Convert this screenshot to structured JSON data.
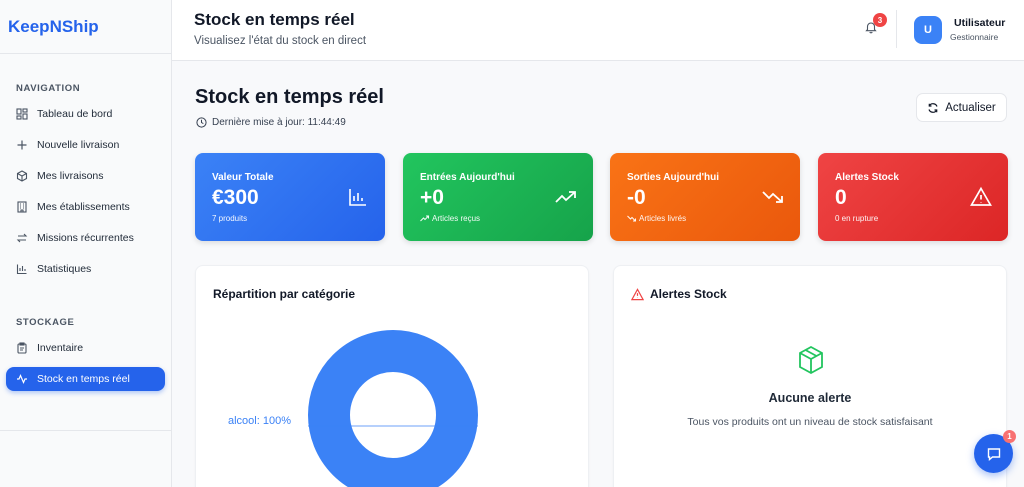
{
  "app": {
    "brand": "KeepNShip"
  },
  "sidebar": {
    "nav_title": "NAVIGATION",
    "nav_items": [
      {
        "label": "Tableau de bord",
        "icon": "dashboard-icon"
      },
      {
        "label": "Nouvelle livraison",
        "icon": "plus-icon"
      },
      {
        "label": "Mes livraisons",
        "icon": "package-icon"
      },
      {
        "label": "Mes établissements",
        "icon": "building-icon"
      },
      {
        "label": "Missions récurrentes",
        "icon": "repeat-icon"
      },
      {
        "label": "Statistiques",
        "icon": "bar-chart-icon"
      }
    ],
    "storage_title": "STOCKAGE",
    "storage_items": [
      {
        "label": "Inventaire",
        "icon": "clipboard-icon"
      },
      {
        "label": "Stock en temps réel",
        "icon": "activity-icon",
        "active": true
      }
    ]
  },
  "header": {
    "title": "Stock en temps réel",
    "subtitle": "Visualisez l'état du stock en direct",
    "notification_count": "3",
    "user": {
      "initial": "U",
      "name": "Utilisateur",
      "role": "Gestionnaire"
    }
  },
  "main": {
    "title": "Stock en temps réel",
    "last_update": "Dernière mise à jour: 11:44:49",
    "refresh_label": "Actualiser",
    "cards": [
      {
        "label": "Valeur Totale",
        "value": "€300",
        "sub": "7 produits",
        "icon": "bar-chart-icon",
        "color": "#2563eb"
      },
      {
        "label": "Entrées Aujourd'hui",
        "value": "+0",
        "sub": "Articles reçus",
        "icon": "trending-up-icon",
        "color": "#16a34a"
      },
      {
        "label": "Sorties Aujourd'hui",
        "value": "-0",
        "sub": "Articles livrés",
        "icon": "trending-down-icon",
        "color": "#ea580c"
      },
      {
        "label": "Alertes Stock",
        "value": "0",
        "sub": "0 en rupture",
        "icon": "alert-triangle-icon",
        "color": "#dc2626"
      }
    ],
    "category_panel": {
      "title": "Répartition par catégorie"
    },
    "alerts_panel": {
      "title": "Alertes Stock",
      "empty_title": "Aucune alerte",
      "empty_sub": "Tous vos produits ont un niveau de stock satisfaisant"
    }
  },
  "chart_data": {
    "type": "pie",
    "categories": [
      "alcool"
    ],
    "values": [
      100
    ],
    "labels": [
      "alcool: 100%"
    ],
    "colors": [
      "#3b82f6"
    ]
  },
  "chat": {
    "badge": "1"
  }
}
